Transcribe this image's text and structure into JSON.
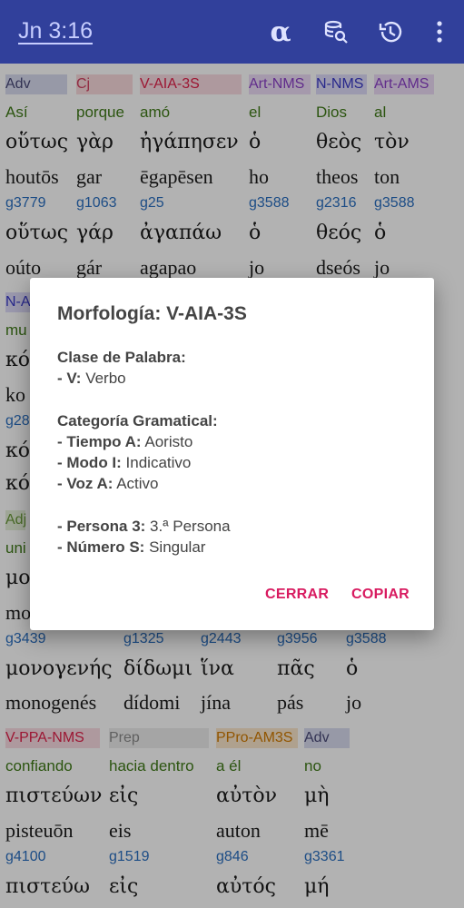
{
  "appbar": {
    "reference": "Jn 3:16",
    "alpha_glyph": "α",
    "icons": [
      "alpha-icon",
      "database-search-icon",
      "history-icon",
      "more-vert-icon"
    ]
  },
  "blocks": [
    {
      "words": [
        {
          "tag": "Adv",
          "es": "Así",
          "gk": "οὕτως",
          "tr": "houtōs",
          "strong": "g3779",
          "gk2": "οὕτως",
          "tr2": "oúto"
        },
        {
          "tag": "Cj",
          "es": "porque",
          "gk": "γὰρ",
          "tr": "gar",
          "strong": "g1063",
          "gk2": "γάρ",
          "tr2": "gár"
        },
        {
          "tag": "V-AIA-3S",
          "es": "amó",
          "gk": "ἠγάπησεν",
          "tr": "ēgapēsen",
          "strong": "g25",
          "gk2": "ἀγαπάω",
          "tr2": "agapao"
        },
        {
          "tag": "Art-NMS",
          "es": "el",
          "gk": "ὁ",
          "tr": "ho",
          "strong": "g3588",
          "gk2": "ὁ",
          "tr2": "jo"
        },
        {
          "tag": "N-NMS",
          "es": "Dios",
          "gk": "θεὸς",
          "tr": "theos",
          "strong": "g2316",
          "gk2": "θεός",
          "tr2": "dseós"
        },
        {
          "tag": "Art-AMS",
          "es": "al",
          "gk": "τὸν",
          "tr": "ton",
          "strong": "g3588",
          "gk2": "ὁ",
          "tr2": "jo"
        }
      ]
    },
    {
      "partial": {
        "tag": "N-A",
        "es": "mu",
        "gk": "κό",
        "tr": "ko",
        "strong": "g28",
        "gk2": "κό",
        "gk3": "κό"
      }
    },
    {
      "partial": {
        "tag": "Adj",
        "es": "uni",
        "gk": "μο",
        "tr": "mo"
      }
    },
    {
      "words": [
        {
          "strong": "g3439",
          "gk2": "μονογενής",
          "tr2": "monogenés"
        },
        {
          "strong": "g1325",
          "gk2": "δίδωμι",
          "tr2": "dídomi"
        },
        {
          "strong": "g2443",
          "gk2": "ἵνα",
          "tr2": "jína"
        },
        {
          "strong": "g3956",
          "gk2": "πᾶς",
          "tr2": "pás"
        },
        {
          "strong": "g3588",
          "gk2": "ὁ",
          "tr2": "jo"
        }
      ]
    },
    {
      "words": [
        {
          "tag": "V-PPA-NMS",
          "es": "confiando",
          "gk": "πιστεύων",
          "tr": "pisteuōn",
          "strong": "g4100",
          "gk2": "πιστεύω"
        },
        {
          "tag": "Prep",
          "es": "hacia dentro",
          "gk": "εἰς",
          "tr": "eis",
          "strong": "g1519",
          "gk2": "εἰς"
        },
        {
          "tag": "PPro-AM3S",
          "es": "a él",
          "gk": "αὐτὸν",
          "tr": "auton",
          "strong": "g846",
          "gk2": "αὐτός"
        },
        {
          "tag": "Adv",
          "es": "no",
          "gk": "μὴ",
          "tr": "mē",
          "strong": "g3361",
          "gk2": "μή"
        }
      ]
    }
  ],
  "dialog": {
    "title": "Morfología: V-AIA-3S",
    "word_class_heading": "Clase de Palabra:",
    "word_class": {
      "key": "- V:",
      "value": "Verbo"
    },
    "grammar_heading": "Categoría Gramatical:",
    "grammar": [
      {
        "key": "- Tiempo A:",
        "value": "Aoristo"
      },
      {
        "key": "- Modo I:",
        "value": "Indicativo"
      },
      {
        "key": "- Voz A:",
        "value": "Activo"
      }
    ],
    "person_number": [
      {
        "key": "- Persona 3:",
        "value": "3.ª Persona"
      },
      {
        "key": "- Número S:",
        "value": "Singular"
      }
    ],
    "close_label": "CERRAR",
    "copy_label": "COPIAR"
  }
}
